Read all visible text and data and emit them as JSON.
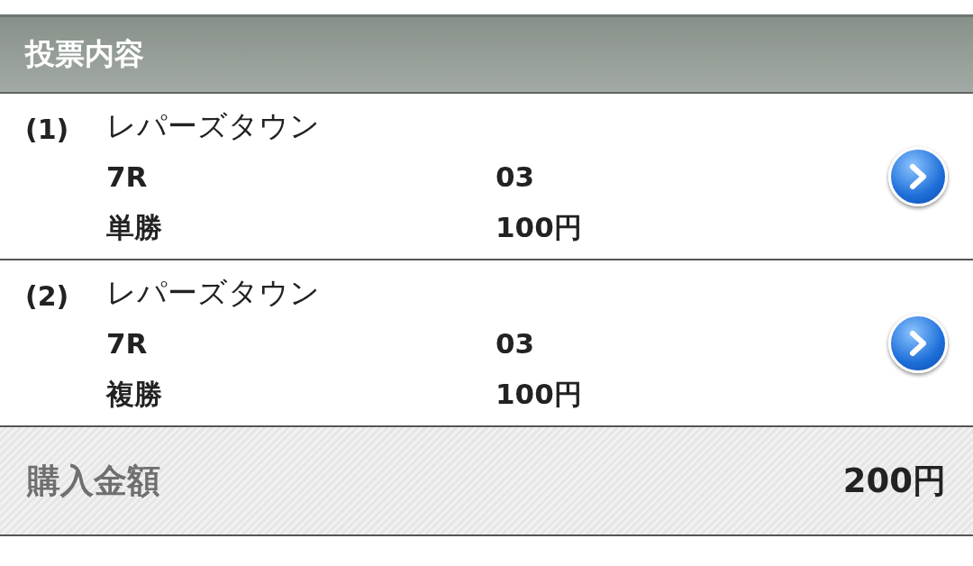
{
  "header": {
    "title": "投票内容"
  },
  "bets": [
    {
      "index": "(1)",
      "name": "レパーズタウン",
      "race": "7R",
      "number": "03",
      "bet_type": "単勝",
      "amount": "100円"
    },
    {
      "index": "(2)",
      "name": "レパーズタウン",
      "race": "7R",
      "number": "03",
      "bet_type": "複勝",
      "amount": "100円"
    }
  ],
  "total": {
    "label": "購入金額",
    "amount": "200円"
  }
}
